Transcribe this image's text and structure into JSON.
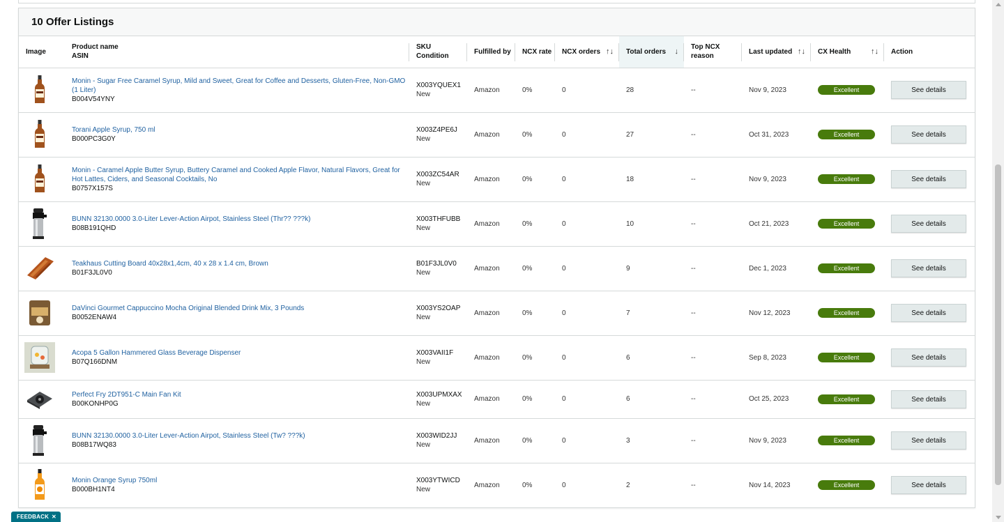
{
  "panel": {
    "title": "10 Offer Listings"
  },
  "columns": {
    "image": "Image",
    "product_name": "Product name",
    "asin": "ASIN",
    "sku": "SKU",
    "condition": "Condition",
    "fulfilled_by": "Fulfilled by",
    "ncx_rate": "NCX rate",
    "ncx_orders": "NCX orders",
    "total_orders": "Total orders",
    "top_ncx_line1": "Top NCX",
    "top_ncx_line2": "reason",
    "last_updated": "Last updated",
    "cx_health": "CX Health",
    "action": "Action"
  },
  "sort_icons": {
    "unsorted": "↑↓",
    "sorted_desc": "↓"
  },
  "rows": [
    {
      "image_icon": "syrup-bottle-icon",
      "name": "Monin - Sugar Free Caramel Syrup, Mild and Sweet, Great for Coffee and Desserts, Gluten-Free, Non-GMO (1 Liter)",
      "asin": "B004V54YNY",
      "sku": "X003YQUEX1",
      "condition": "New",
      "fulfilled_by": "Amazon",
      "ncx_rate": "0%",
      "ncx_orders": "0",
      "total_orders": "28",
      "top_ncx": "--",
      "last_updated": "Nov 9, 2023",
      "cx_health": "Excellent",
      "action": "See details"
    },
    {
      "image_icon": "syrup-bottle-icon",
      "name": "Torani Apple Syrup, 750 ml",
      "asin": "B000PC3G0Y",
      "sku": "X003Z4PE6J",
      "condition": "New",
      "fulfilled_by": "Amazon",
      "ncx_rate": "0%",
      "ncx_orders": "0",
      "total_orders": "27",
      "top_ncx": "--",
      "last_updated": "Oct 31, 2023",
      "cx_health": "Excellent",
      "action": "See details"
    },
    {
      "image_icon": "syrup-bottle-icon",
      "name": "Monin - Caramel Apple Butter Syrup, Buttery Caramel and Cooked Apple Flavor, Natural Flavors, Great for Hot Lattes, Ciders, and Seasonal Cocktails, No",
      "asin": "B0757X157S",
      "sku": "X003ZC54AR",
      "condition": "New",
      "fulfilled_by": "Amazon",
      "ncx_rate": "0%",
      "ncx_orders": "0",
      "total_orders": "18",
      "top_ncx": "--",
      "last_updated": "Nov 9, 2023",
      "cx_health": "Excellent",
      "action": "See details"
    },
    {
      "image_icon": "airpot-icon",
      "name": "BUNN 32130.0000 3.0-Liter Lever-Action Airpot, Stainless Steel (Thr?? ???k)",
      "asin": "B08B191QHD",
      "sku": "X003THFUBB",
      "condition": "New",
      "fulfilled_by": "Amazon",
      "ncx_rate": "0%",
      "ncx_orders": "0",
      "total_orders": "10",
      "top_ncx": "--",
      "last_updated": "Oct 21, 2023",
      "cx_health": "Excellent",
      "action": "See details"
    },
    {
      "image_icon": "cutting-board-icon",
      "name": "Teakhaus Cutting Board 40x28x1,4cm, 40 x 28 x 1.4 cm, Brown",
      "asin": "B01F3JL0V0",
      "sku": "B01F3JL0V0",
      "condition": "New",
      "fulfilled_by": "Amazon",
      "ncx_rate": "0%",
      "ncx_orders": "0",
      "total_orders": "9",
      "top_ncx": "--",
      "last_updated": "Dec 1, 2023",
      "cx_health": "Excellent",
      "action": "See details"
    },
    {
      "image_icon": "drink-mix-bag-icon",
      "name": "DaVinci Gourmet Cappuccino Mocha Original Blended Drink Mix, 3 Pounds",
      "asin": "B0052ENAW4",
      "sku": "X003YS2OAP",
      "condition": "New",
      "fulfilled_by": "Amazon",
      "ncx_rate": "0%",
      "ncx_orders": "0",
      "total_orders": "7",
      "top_ncx": "--",
      "last_updated": "Nov 12, 2023",
      "cx_health": "Excellent",
      "action": "See details"
    },
    {
      "image_icon": "beverage-dispenser-icon",
      "name": "Acopa 5 Gallon Hammered Glass Beverage Dispenser",
      "asin": "B07Q166DNM",
      "sku": "X003VAII1F",
      "condition": "New",
      "fulfilled_by": "Amazon",
      "ncx_rate": "0%",
      "ncx_orders": "0",
      "total_orders": "6",
      "top_ncx": "--",
      "last_updated": "Sep 8, 2023",
      "cx_health": "Excellent",
      "action": "See details"
    },
    {
      "image_icon": "fan-kit-icon",
      "name": "Perfect Fry 2DT951-C Main Fan Kit",
      "asin": "B00KONHP0G",
      "sku": "X003UPMXAX",
      "condition": "New",
      "fulfilled_by": "Amazon",
      "ncx_rate": "0%",
      "ncx_orders": "0",
      "total_orders": "6",
      "top_ncx": "--",
      "last_updated": "Oct 25, 2023",
      "cx_health": "Excellent",
      "action": "See details"
    },
    {
      "image_icon": "airpot-icon",
      "name": "BUNN 32130.0000 3.0-Liter Lever-Action Airpot, Stainless Steel (Tw? ???k)",
      "asin": "B08B17WQ83",
      "sku": "X003WID2JJ",
      "condition": "New",
      "fulfilled_by": "Amazon",
      "ncx_rate": "0%",
      "ncx_orders": "0",
      "total_orders": "3",
      "top_ncx": "--",
      "last_updated": "Nov 9, 2023",
      "cx_health": "Excellent",
      "action": "See details"
    },
    {
      "image_icon": "orange-syrup-bottle-icon",
      "name": "Monin Orange Syrup 750ml",
      "asin": "B000BH1NT4",
      "sku": "X003YTWICD",
      "condition": "New",
      "fulfilled_by": "Amazon",
      "ncx_rate": "0%",
      "ncx_orders": "0",
      "total_orders": "2",
      "top_ncx": "--",
      "last_updated": "Nov 14, 2023",
      "cx_health": "Excellent",
      "action": "See details"
    }
  ],
  "feedback": {
    "label": "FEEDBACK",
    "close": "✕"
  },
  "colors": {
    "health_excellent": "#487b0c",
    "link": "#2162a1",
    "feedback": "#007185",
    "sorted_header_bg": "#eef5f6"
  }
}
